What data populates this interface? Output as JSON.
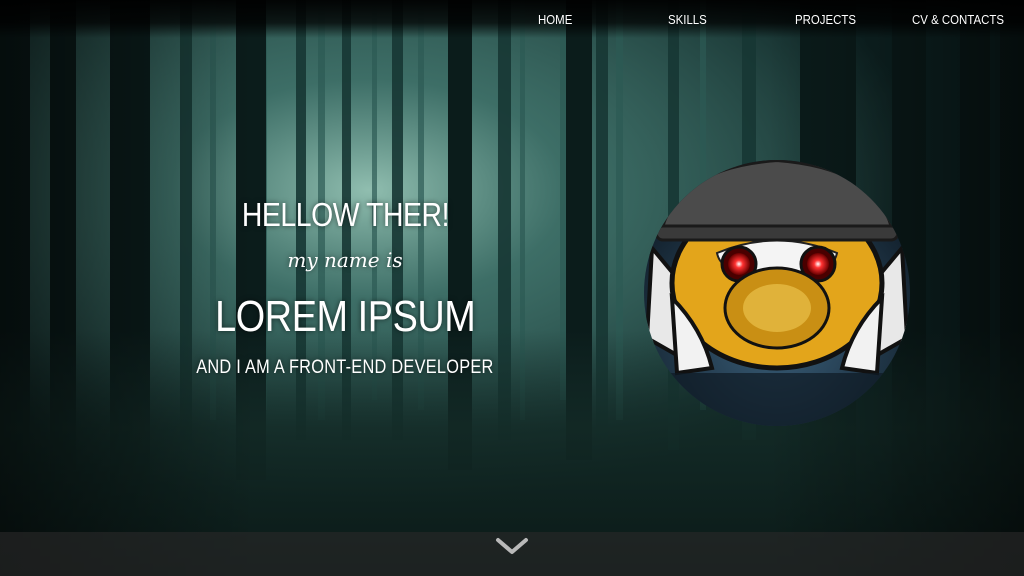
{
  "nav": {
    "items": [
      {
        "label": "HOME"
      },
      {
        "label": "SKILLS"
      },
      {
        "label": "PROJECTS"
      },
      {
        "label": "CV & CONTACTS"
      }
    ]
  },
  "hero": {
    "greeting": "HELLOW THER!",
    "subline": "my name is",
    "name": "LOREM IPSUM",
    "role": "AND I AM A FRONT-END DEVELOPER"
  },
  "colors": {
    "forest_dark": "#0b1a1a",
    "forest_mid": "#1f4a46",
    "forest_light": "#6fa79c",
    "text": "#ffffff",
    "avatar_orange": "#e0a11a",
    "avatar_eye": "#ff2a2a",
    "footer_bar": "#2a2a2a"
  },
  "icons": {
    "scroll_down": "chevron-down-icon"
  }
}
